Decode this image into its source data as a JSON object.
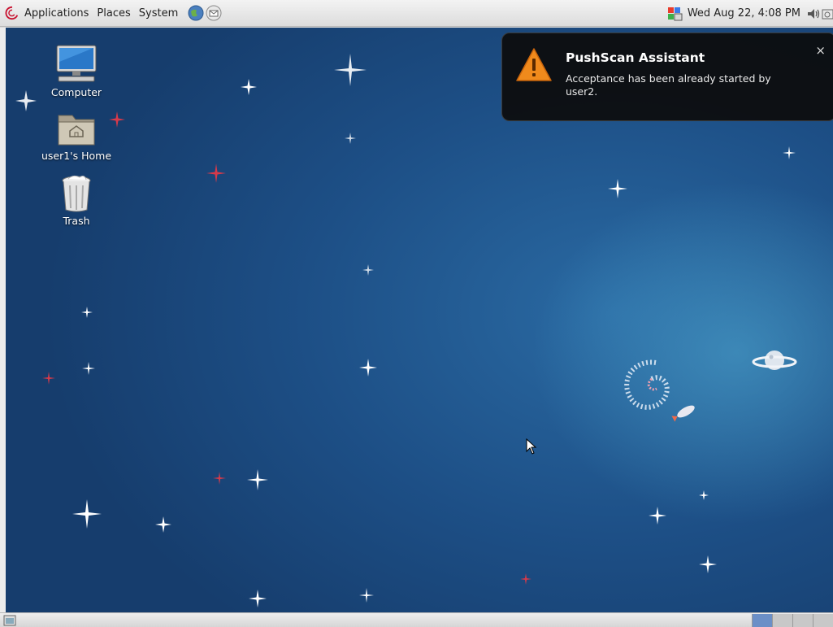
{
  "top_panel": {
    "menus": [
      "Applications",
      "Places",
      "System"
    ],
    "clock": "Wed Aug 22,  4:08 PM"
  },
  "desktop_icons": [
    {
      "label": "Computer",
      "icon": "computer-icon"
    },
    {
      "label": "user1's Home",
      "icon": "home-folder-icon"
    },
    {
      "label": "Trash",
      "icon": "trash-icon"
    }
  ],
  "notification": {
    "title": "PushScan Assistant",
    "body": "Acceptance has been already started by user2.",
    "close": "×",
    "icon": "warning-icon"
  },
  "colors": {
    "desktop_bg": "#1d4f86",
    "notify_bg": "#0c0c0c",
    "warning": "#f08a1c",
    "workspace_active": "#6b8fc7"
  },
  "workspaces": {
    "count": 4,
    "active_index": 0
  }
}
